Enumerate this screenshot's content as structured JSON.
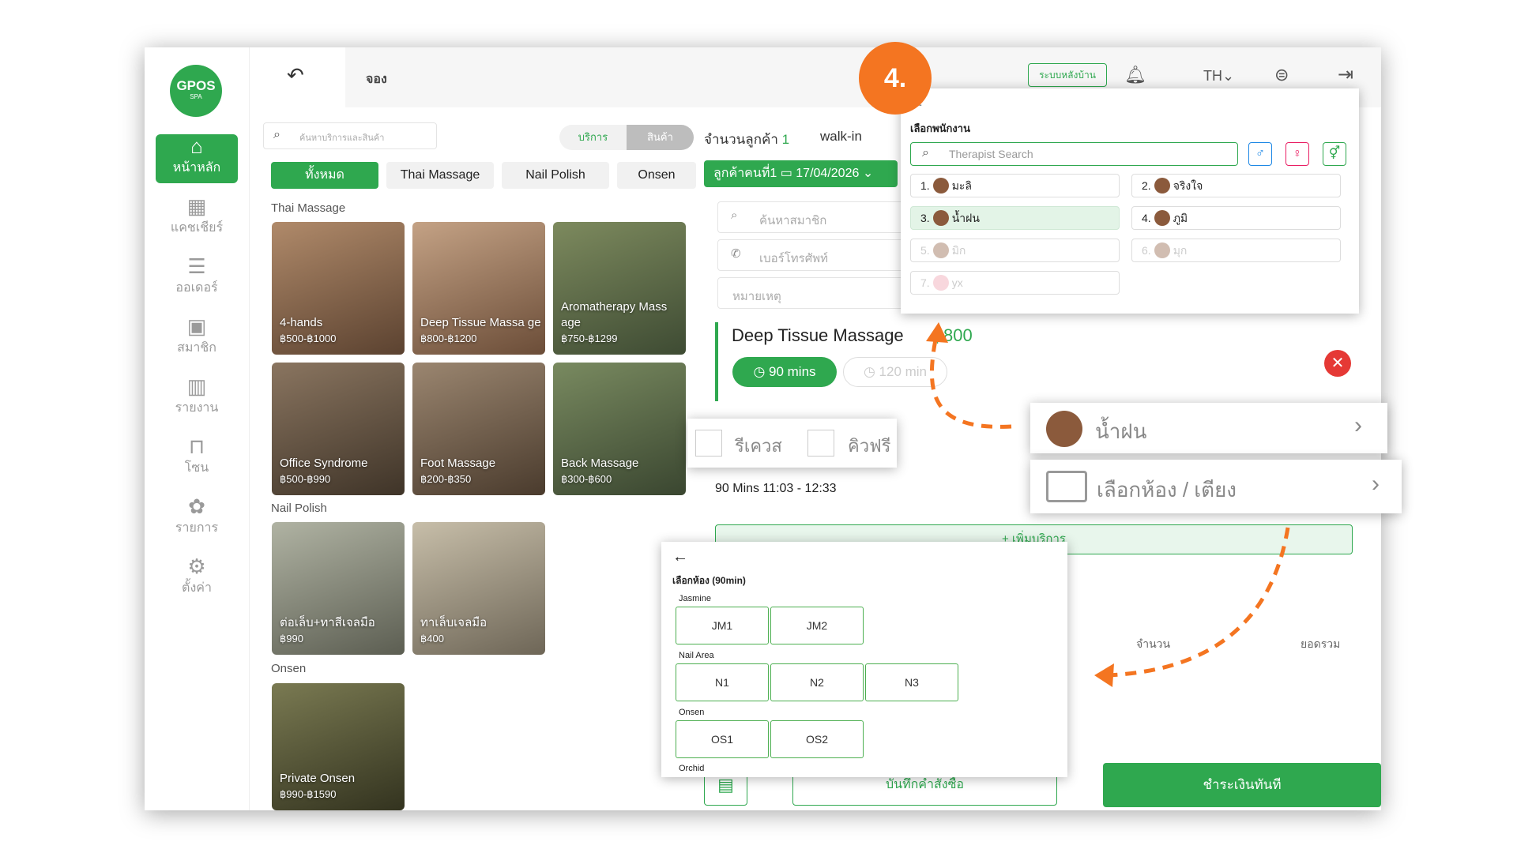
{
  "app": {
    "logo_text": "GPOS",
    "logo_sub": "SPA",
    "back_icon": "undo-icon",
    "page_title": "จอง"
  },
  "header": {
    "backoffice_label": "ระบบหลังบ้าน",
    "lang": "TH",
    "lang_caret": "⌄"
  },
  "sidebar": {
    "items": [
      {
        "label": "หน้าหลัก",
        "icon": "home-icon"
      },
      {
        "label": "แคชเชียร์",
        "icon": "cashier-icon"
      },
      {
        "label": "ออเดอร์",
        "icon": "order-icon"
      },
      {
        "label": "สมาชิก",
        "icon": "member-icon"
      },
      {
        "label": "รายงาน",
        "icon": "report-icon"
      },
      {
        "label": "โซน",
        "icon": "zone-icon"
      },
      {
        "label": "รายการ",
        "icon": "list-icon"
      },
      {
        "label": "ตั้งค่า",
        "icon": "settings-icon"
      }
    ]
  },
  "search": {
    "placeholder": "ค้นหาบริการและสินค้า"
  },
  "tabs": {
    "service": "บริการ",
    "product": "สินค้า"
  },
  "customer": {
    "count_label": "จำนวนลูกค้า",
    "count": "1",
    "type": "walk-in",
    "customer_tab": "ลูกค้าคนที่1",
    "date": "17/04/2026",
    "member_search": "ค้นหาสมาชิก",
    "phone": "เบอร์โทรศัพท์",
    "note": "หมายเหตุ"
  },
  "categories": [
    "ทั้งหมด",
    "Thai Massage",
    "Nail Polish",
    "Onsen"
  ],
  "sections": [
    {
      "title": "Thai Massage",
      "items": [
        {
          "name": "4-hands",
          "price": "฿500-฿1000",
          "color": "#8a6a4f"
        },
        {
          "name": "Deep Tissue Massa ge",
          "price": "฿800-฿1200",
          "color": "#9b7b62"
        },
        {
          "name": "Aromatherapy Mass age",
          "price": "฿750-฿1299",
          "color": "#6e7a55"
        },
        {
          "name": "Office Syndrome",
          "price": "฿500-฿990",
          "color": "#6b5a45"
        },
        {
          "name": "Foot Massage",
          "price": "฿200-฿350",
          "color": "#7d6b58"
        },
        {
          "name": "Back Massage",
          "price": "฿300-฿600",
          "color": "#5f6e4c"
        }
      ]
    },
    {
      "title": "Nail Polish",
      "items": [
        {
          "name": "ต่อเล็บ+ทาสีเจลมือ",
          "price": "฿990",
          "color": "#8c8f80"
        },
        {
          "name": "ทาเล็บเจลมือ",
          "price": "฿400",
          "color": "#a29a86"
        }
      ]
    },
    {
      "title": "Onsen",
      "items": [
        {
          "name": "Private Onsen",
          "price": "฿990-฿1590",
          "color": "#5a5a3d"
        }
      ]
    }
  ],
  "selected_service": {
    "name": "Deep Tissue Massage",
    "price": "฿800",
    "duration_active": "90 mins",
    "duration_other": "120 min",
    "time_text": "90 Mins  11:03 - 12:33"
  },
  "checkboxes": {
    "request": "รีเควส",
    "free_queue": "คิวฟรี"
  },
  "therapist_row": {
    "name": "น้ำฝน"
  },
  "room_row": {
    "label": "เลือกห้อง / เตียง"
  },
  "add_service": "+ เพิ่มบริการ",
  "totals": {
    "qty_label": "จำนวน",
    "sum_label": "ยอดรวม"
  },
  "footer": {
    "save_order": "บันทึกคำสั่งซื้อ",
    "pay_now": "ชำระเงินทันที"
  },
  "step_badge": "4.",
  "therapist_panel": {
    "title": "เลือกพนักงาน",
    "search_placeholder": "Therapist Search",
    "staff": [
      {
        "no": "1.",
        "name": "มะลิ",
        "selected": false,
        "disabled": false
      },
      {
        "no": "2.",
        "name": "จริงใจ",
        "selected": false,
        "disabled": false
      },
      {
        "no": "3.",
        "name": "น้ำฝน",
        "selected": true,
        "disabled": false
      },
      {
        "no": "4.",
        "name": "ภูมิ",
        "selected": false,
        "disabled": false
      },
      {
        "no": "5.",
        "name": "มิก",
        "selected": false,
        "disabled": true
      },
      {
        "no": "6.",
        "name": "มุก",
        "selected": false,
        "disabled": true
      },
      {
        "no": "7.",
        "name": "yx",
        "selected": false,
        "disabled": true
      }
    ]
  },
  "room_panel": {
    "title": "เลือกห้อง (90min)",
    "groups": [
      {
        "name": "Jasmine",
        "rooms": [
          "JM1",
          "JM2"
        ]
      },
      {
        "name": "Nail Area",
        "rooms": [
          "N1",
          "N2",
          "N3"
        ]
      },
      {
        "name": "Onsen",
        "rooms": [
          "OS1",
          "OS2"
        ]
      },
      {
        "name": "Orchid",
        "rooms": []
      }
    ]
  },
  "colors": {
    "green": "#2fa84f",
    "orange": "#f47521",
    "red": "#e53935"
  }
}
